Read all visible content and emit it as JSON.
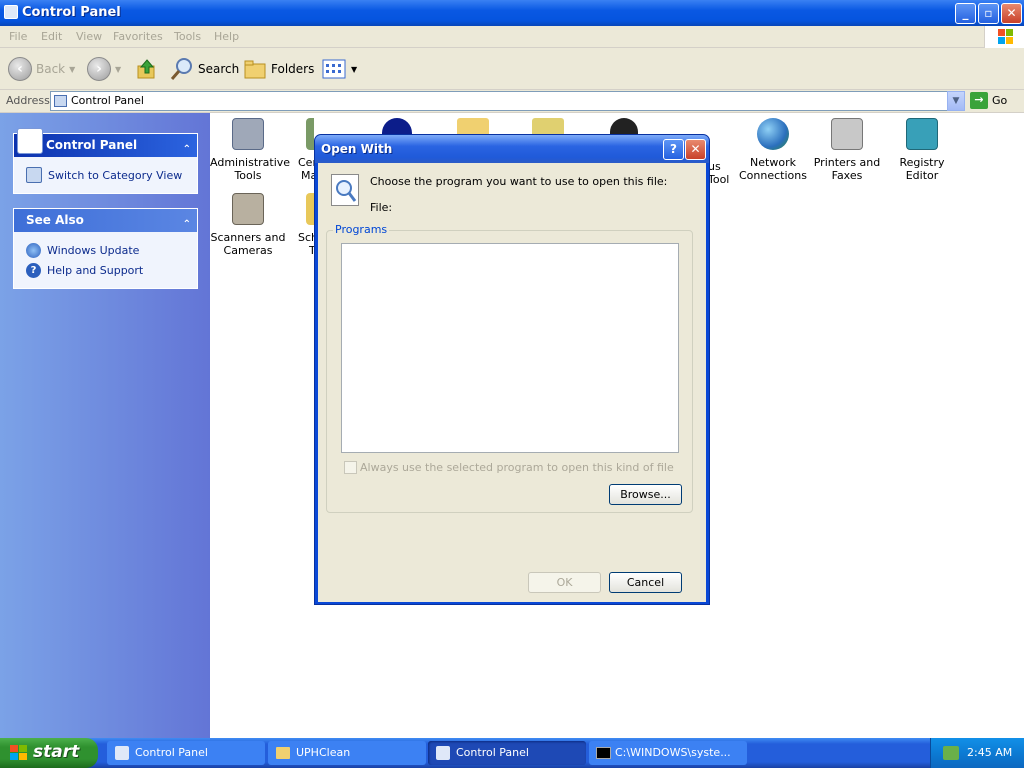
{
  "window": {
    "title": "Control Panel",
    "min": "_",
    "max": "▫",
    "close": "✕"
  },
  "menu": [
    "File",
    "Edit",
    "View",
    "Favorites",
    "Tools",
    "Help"
  ],
  "toolbar": {
    "back": "Back",
    "search": "Search",
    "folders": "Folders"
  },
  "address": {
    "label": "Address",
    "value": "Control Panel",
    "go": "Go"
  },
  "left_panel": {
    "control_panel_title": "Control Panel",
    "switch_view": "Switch to Category View",
    "see_also_title": "See Also",
    "see_also_items": [
      "Windows Update",
      "Help and Support"
    ]
  },
  "icons": [
    {
      "label": "Administrative Tools",
      "color": "#9fa8b8"
    },
    {
      "label": "Certificate Manager",
      "color": "#7a9a66"
    },
    {
      "label": "Network Connections",
      "color": "#2b8a3b"
    },
    {
      "label": "Printers and Faxes",
      "color": "#c8c8c8"
    },
    {
      "label": "Registry Editor",
      "color": "#38a0b8"
    },
    {
      "label": "Scanners and Cameras",
      "color": "#b8b0a0"
    },
    {
      "label": "Scheduled Tasks",
      "color": "#e8c85a"
    }
  ],
  "partial_labels": {
    "cert": [
      "Cer",
      "Ma"
    ],
    "tool": [
      "us",
      "Tool"
    ],
    "sched": [
      "Sch",
      "T"
    ]
  },
  "dialog": {
    "title": "Open With",
    "help": "?",
    "close": "✕",
    "prompt": "Choose the program you want to use to open this file:",
    "file_label": "File:",
    "group_label": "Programs",
    "always_use": "Always use the selected program to open this kind of file",
    "browse": "Browse...",
    "ok": "OK",
    "cancel": "Cancel"
  },
  "taskbar": {
    "start": "start",
    "items": [
      "Control Panel",
      "UPHClean",
      "Control Panel",
      "C:\\WINDOWS\\syste..."
    ],
    "active_index": 2,
    "clock": "2:45 AM"
  }
}
